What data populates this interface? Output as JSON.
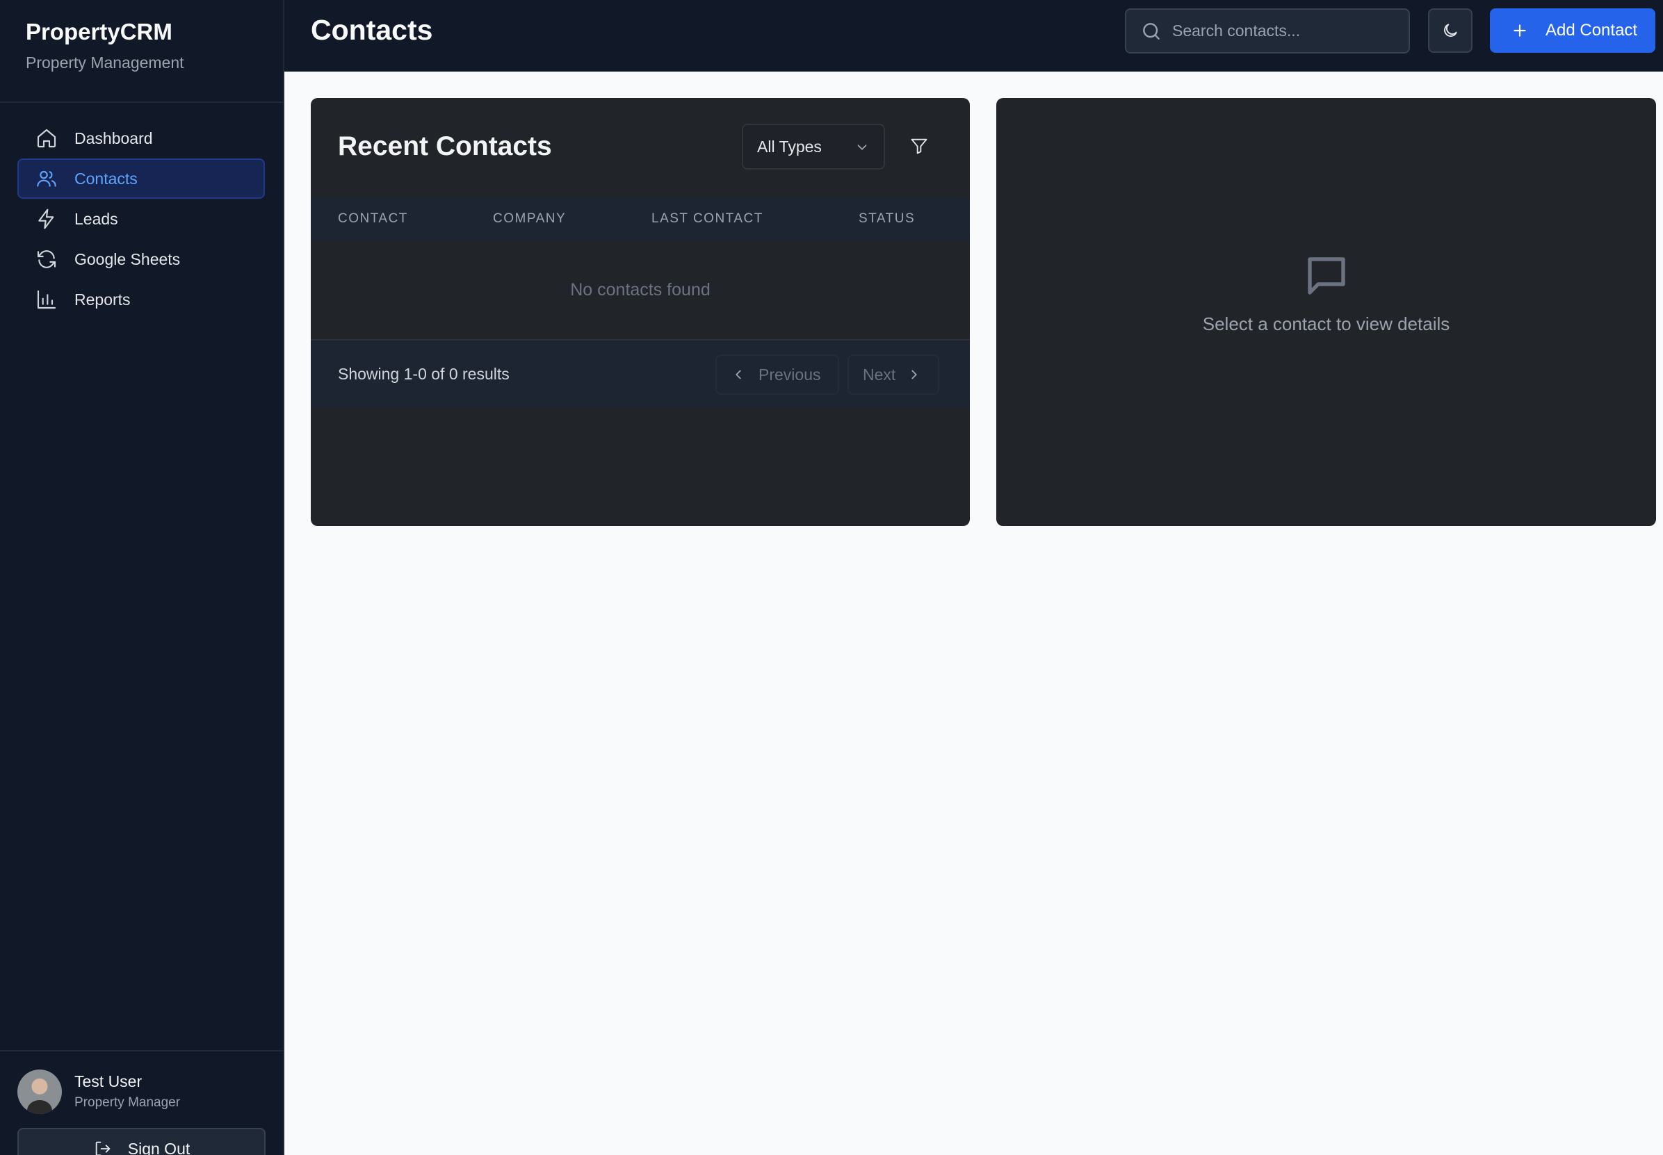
{
  "brand": {
    "title": "PropertyCRM",
    "subtitle": "Property Management"
  },
  "sidebar": {
    "items": [
      {
        "label": "Dashboard",
        "icon": "home-icon",
        "active": false
      },
      {
        "label": "Contacts",
        "icon": "users-icon",
        "active": true
      },
      {
        "label": "Leads",
        "icon": "lightning-icon",
        "active": false
      },
      {
        "label": "Google Sheets",
        "icon": "refresh-icon",
        "active": false
      },
      {
        "label": "Reports",
        "icon": "bar-chart-icon",
        "active": false
      }
    ]
  },
  "user": {
    "name": "Test User",
    "role": "Property Manager",
    "signout_label": "Sign Out"
  },
  "header": {
    "title": "Contacts",
    "search_placeholder": "Search contacts...",
    "add_label": "Add Contact"
  },
  "contacts_panel": {
    "title": "Recent Contacts",
    "type_filter": "All Types",
    "columns": [
      "CONTACT",
      "COMPANY",
      "LAST CONTACT",
      "STATUS"
    ],
    "empty_text": "No contacts found",
    "pagination": {
      "info": "Showing 1-0 of 0 results",
      "prev_label": "Previous",
      "next_label": "Next"
    }
  },
  "detail_panel": {
    "empty_text": "Select a contact to view details"
  },
  "colors": {
    "accent": "#2563eb",
    "sidebar_bg": "#111827",
    "card_bg": "#212428",
    "active_text": "#60a5fa"
  }
}
